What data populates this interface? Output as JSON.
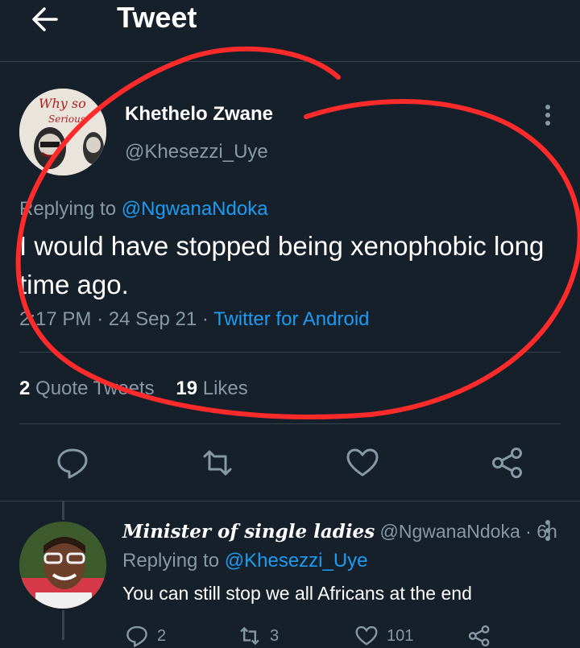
{
  "header": {
    "title": "Tweet"
  },
  "tweet": {
    "author_name": "Khethelo Zwane",
    "author_handle": "@Khesezzi_Uye",
    "avatar_text_line1": "Why so",
    "avatar_text_line2": "Serious",
    "replying_prefix": "Replying to",
    "replying_to": "@NgwanaNdoka",
    "text": "I would have stopped being xenophobic long time ago.",
    "time": "2:17 PM",
    "date": "24 Sep 21",
    "source": "Twitter for Android",
    "separator": "·",
    "quote_count": "2",
    "quote_label": "Quote Tweets",
    "like_count": "19",
    "like_label": "Likes"
  },
  "reply": {
    "display_name": "Minister of single ladies",
    "handle": "@NgwanaNdoka",
    "separator": "·",
    "age": "6h",
    "replying_prefix": "Replying to",
    "replying_to": "@Khesezzi_Uye",
    "text": "You can still stop we all Africans at the end",
    "reply_count": "2",
    "retweet_count": "3",
    "like_count": "101"
  },
  "colors": {
    "background": "#15202b",
    "link": "#1d9bf0",
    "muted": "#8899a6",
    "divider": "#38444d",
    "annotation": "#ff2a2a"
  },
  "icons": [
    "back-arrow-icon",
    "more-vertical-icon",
    "reply-icon",
    "retweet-icon",
    "like-icon",
    "share-icon"
  ]
}
